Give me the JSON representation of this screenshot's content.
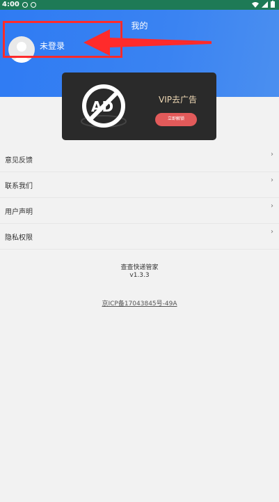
{
  "status_bar": {
    "time": "4:00"
  },
  "header": {
    "title": "我的",
    "username": "未登录"
  },
  "vip_banner": {
    "title": "VIP去广告",
    "button_label": "立即解锁",
    "ad_text": "AD"
  },
  "menu": {
    "items": [
      {
        "label": "意见反馈",
        "chevron": "›"
      },
      {
        "label": "联系我们",
        "chevron": "›"
      },
      {
        "label": "用户声明",
        "chevron": "›"
      },
      {
        "label": "隐私权限",
        "chevron": "›"
      }
    ]
  },
  "footer": {
    "app_name": "查查快递管家",
    "version": "v1.3.3",
    "icp": "京ICP备17043845号-49A"
  },
  "colors": {
    "header_blue": "#2f7bf3",
    "status_green": "#1e7a56",
    "annotation_red": "#ff2b2b",
    "vip_button": "#e25a5a"
  },
  "icons": [
    "wifi-icon",
    "battery-icon",
    "no-ad-icon",
    "avatar-icon",
    "chevron-right-icon"
  ]
}
